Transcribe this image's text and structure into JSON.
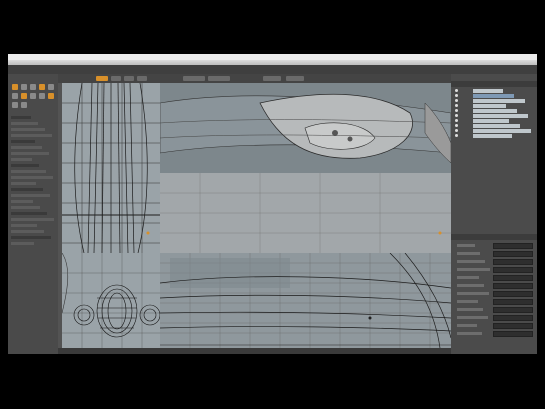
{
  "menubar": {
    "items": []
  },
  "window": {
    "title": ""
  },
  "tabs": [],
  "left_panel": {
    "tool_icons": [
      "move-icon",
      "rotate-icon",
      "scale-icon",
      "transform-icon",
      "pen-icon",
      "bevel-icon",
      "extrude-icon",
      "loop-slice-icon",
      "bridge-icon",
      "merge-icon",
      "select-icon",
      "paint-icon"
    ]
  },
  "viewports": [
    {
      "name": "top-left-front"
    },
    {
      "name": "top-right-perspective"
    },
    {
      "name": "bottom-left-side"
    },
    {
      "name": "bottom-right-top"
    }
  ],
  "right_panel": {
    "tree_rows": 10,
    "properties": 12
  },
  "colors": {
    "accent": "#d8902a",
    "selection": "#7e99b5",
    "panel": "#4b4b4b",
    "viewport": "#8f989d"
  }
}
